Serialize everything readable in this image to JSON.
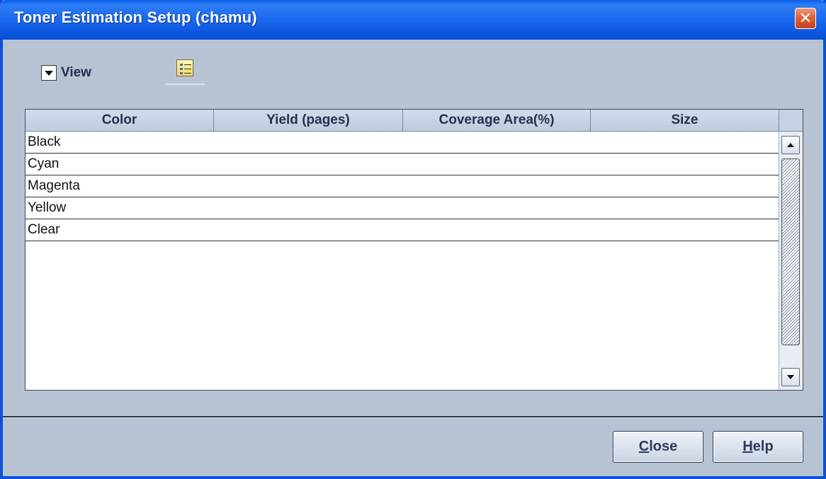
{
  "window": {
    "title": "Toner Estimation Setup (chamu)",
    "title_bar_color": "#0a5ee8",
    "close_icon": "close-x-icon"
  },
  "toolbar": {
    "view_label": "View",
    "view_icon": "chevron-down-icon",
    "list_button_icon": "list-settings-icon"
  },
  "table": {
    "columns": [
      "Color",
      "Yield (pages)",
      "Coverage Area(%)",
      "Size"
    ],
    "rows": [
      {
        "color": "Black",
        "yield": "",
        "coverage": "",
        "size": ""
      },
      {
        "color": "Cyan",
        "yield": "",
        "coverage": "",
        "size": ""
      },
      {
        "color": "Magenta",
        "yield": "",
        "coverage": "",
        "size": ""
      },
      {
        "color": "Yellow",
        "yield": "",
        "coverage": "",
        "size": ""
      },
      {
        "color": "Clear",
        "yield": "",
        "coverage": "",
        "size": ""
      }
    ]
  },
  "buttons": {
    "close_mnemonic": "C",
    "close_rest": "lose",
    "help_mnemonic": "H",
    "help_rest": "elp"
  }
}
